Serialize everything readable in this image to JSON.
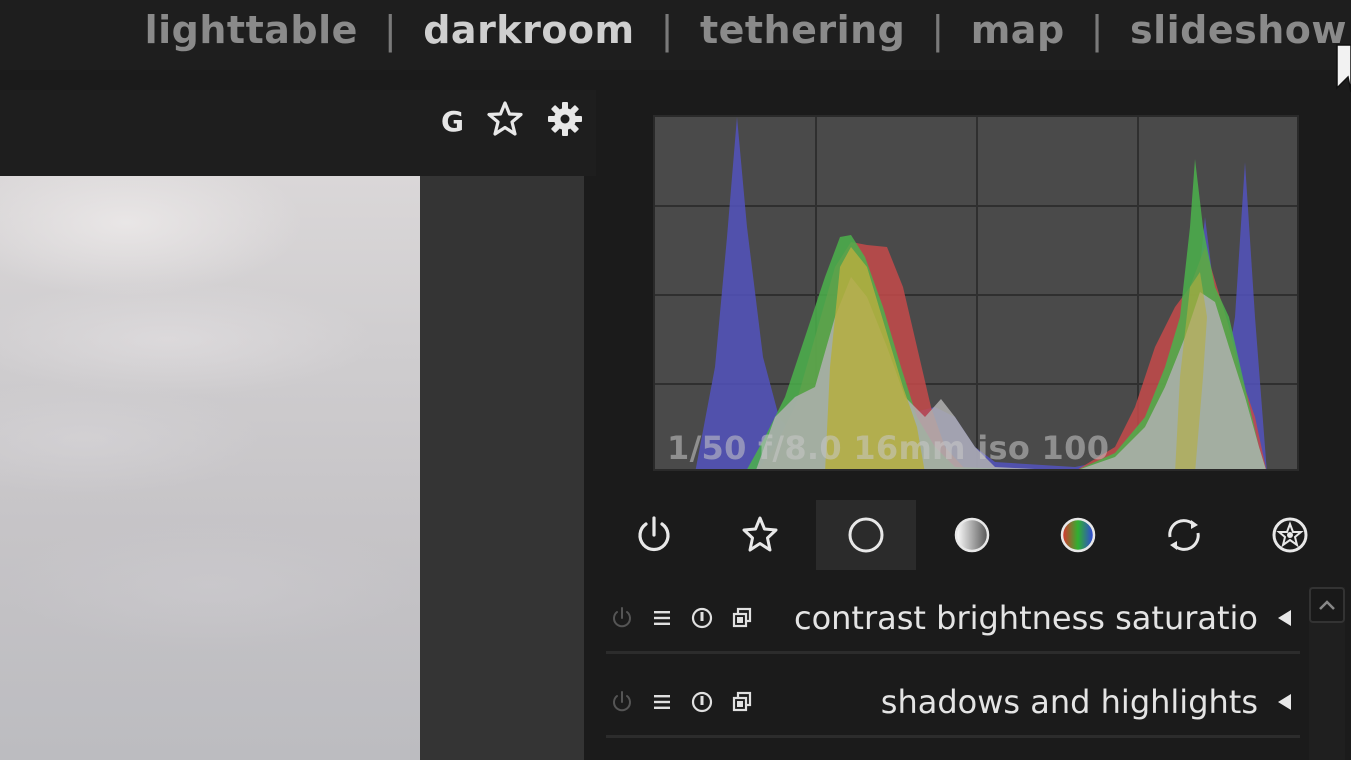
{
  "app": {
    "views": [
      {
        "label": "lighttable",
        "active": false
      },
      {
        "label": "darkroom",
        "active": true
      },
      {
        "label": "tethering",
        "active": false
      },
      {
        "label": "map",
        "active": false
      },
      {
        "label": "slideshow",
        "active": false
      }
    ],
    "separator": "|"
  },
  "center_toolbar": {
    "grouping_label": "G",
    "icons": [
      "star-icon",
      "gear-icon"
    ]
  },
  "histogram": {
    "exif_text": "1/50 f/8.0 16mm iso 100",
    "channel_colors": {
      "red": "#c84040",
      "green": "#40b040",
      "blue": "#5050c0",
      "overlap": "#a8a8a8"
    }
  },
  "module_groups": {
    "items": [
      {
        "name": "active-modules",
        "icon": "power-icon",
        "active": false
      },
      {
        "name": "favorites",
        "icon": "star-outline-icon",
        "active": false
      },
      {
        "name": "basic",
        "icon": "circle-icon",
        "active": true
      },
      {
        "name": "tone",
        "icon": "gradient-circle-icon",
        "active": false
      },
      {
        "name": "color",
        "icon": "color-wheel-icon",
        "active": false
      },
      {
        "name": "correct",
        "icon": "arrows-circle-icon",
        "active": false
      },
      {
        "name": "effect",
        "icon": "effect-circle-icon",
        "active": false
      }
    ]
  },
  "modules": [
    {
      "label": "contrast brightness saturatio",
      "expanded": false
    },
    {
      "label": "shadows and highlights",
      "expanded": false
    }
  ],
  "colors": {
    "background": "#1b1b1b",
    "panel": "#1e1e1e",
    "text_active": "#cfcfcf",
    "text_inactive": "#8a8a8a",
    "accent_group_bg": "#2b2b2b"
  }
}
